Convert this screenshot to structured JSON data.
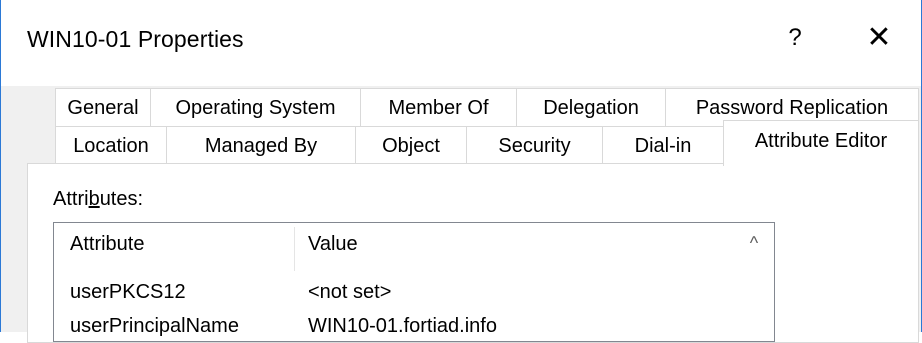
{
  "window": {
    "title": "WIN10-01 Properties",
    "help_label": "?",
    "close_label": "✕"
  },
  "tabs_row1": [
    {
      "label": "General"
    },
    {
      "label": "Operating System"
    },
    {
      "label": "Member Of"
    },
    {
      "label": "Delegation"
    },
    {
      "label": "Password Replication"
    }
  ],
  "tabs_row2": [
    {
      "label": "Location"
    },
    {
      "label": "Managed By"
    },
    {
      "label": "Object"
    },
    {
      "label": "Security"
    },
    {
      "label": "Dial-in"
    },
    {
      "label": "Attribute Editor",
      "active": true
    }
  ],
  "attributes": {
    "label_pre": "Attri",
    "label_mnemonic": "b",
    "label_post": "utes:",
    "columns": [
      "Attribute",
      "Value"
    ],
    "rows": [
      {
        "attribute": "userPKCS12",
        "value": "<not set>"
      },
      {
        "attribute": "userPrincipalName",
        "value": "WIN10-01.fortiad.info"
      }
    ],
    "scroll_up_glyph": "^"
  }
}
